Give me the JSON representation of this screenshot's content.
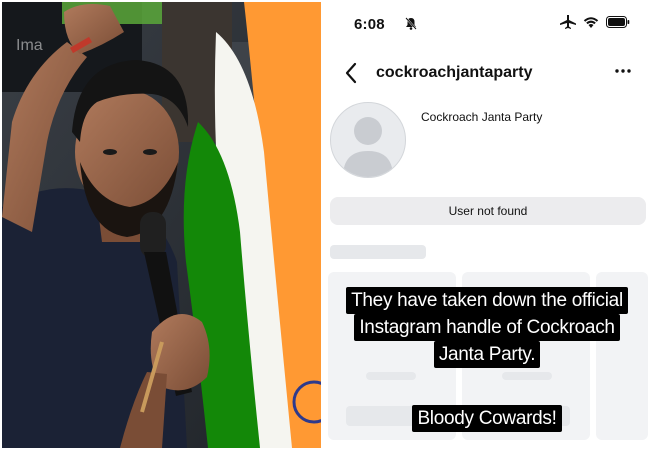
{
  "status_bar": {
    "time": "6:08",
    "icons": [
      "bell-off-icon",
      "airplane-icon",
      "wifi-icon",
      "battery-icon"
    ]
  },
  "profile_header": {
    "username": "cockroachjantaparty",
    "display_name": "Cockroach Janta Party"
  },
  "profile_state": {
    "message": "User not found"
  },
  "caption": {
    "lines": [
      "They have taken down the official",
      "Instagram handle of Cockroach",
      "Janta Party."
    ],
    "secondary": "Bloody Cowards!"
  },
  "colors": {
    "caption_bg": "#000000",
    "caption_text": "#ffffff",
    "pill_bg": "#ececee",
    "flag_saffron": "#ff9933",
    "flag_green": "#138808",
    "chakra_blue": "#2e3a8c"
  }
}
